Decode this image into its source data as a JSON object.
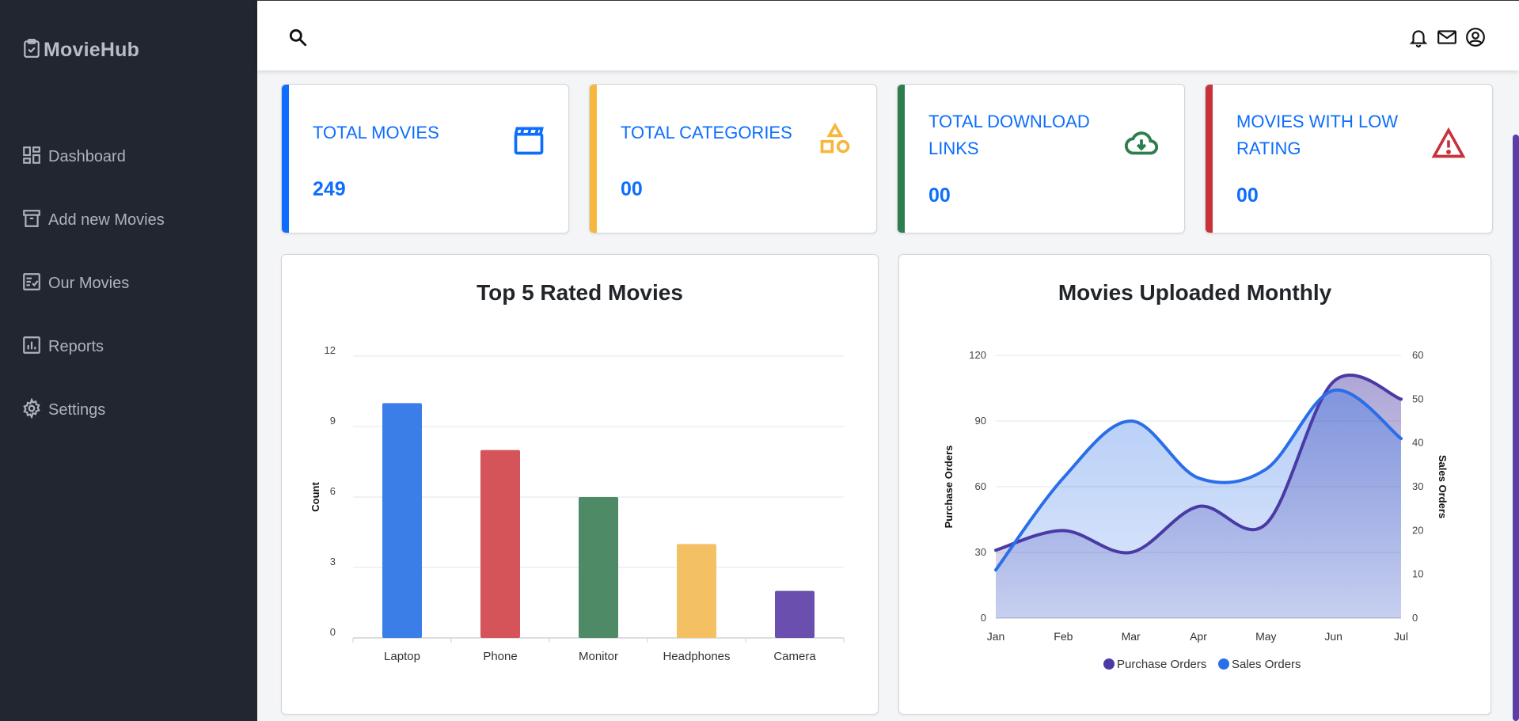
{
  "sidebar": {
    "brand": "MovieHub",
    "items": [
      {
        "label": "Dashboard",
        "icon": "dashboard-icon"
      },
      {
        "label": "Add new Movies",
        "icon": "archive-icon"
      },
      {
        "label": "Our Movies",
        "icon": "list-check-icon"
      },
      {
        "label": "Reports",
        "icon": "bar-chart-icon"
      },
      {
        "label": "Settings",
        "icon": "gear-icon"
      }
    ]
  },
  "topbar": {
    "icons": [
      "search-icon",
      "bell-icon",
      "mail-icon",
      "user-circle-icon"
    ]
  },
  "stats": [
    {
      "title": "TOTAL MOVIES",
      "value": "249",
      "accent": "#0d6efd",
      "icon": "clapperboard-icon"
    },
    {
      "title": "TOTAL CATEGORIES",
      "value": "00",
      "accent": "#f6b73c",
      "icon": "shapes-icon"
    },
    {
      "title": "TOTAL DOWNLOAD LINKS",
      "value": "00",
      "accent": "#2e7d4f",
      "icon": "cloud-download-icon"
    },
    {
      "title": "MOVIES WITH LOW RATING",
      "value": "00",
      "accent": "#c8333b",
      "icon": "warning-icon"
    }
  ],
  "chart_data": [
    {
      "type": "bar",
      "title": "Top 5 Rated Movies",
      "ylabel": "Count",
      "xlabel": "",
      "categories": [
        "Laptop",
        "Phone",
        "Monitor",
        "Headphones",
        "Camera"
      ],
      "values": [
        10,
        8,
        6,
        4,
        2
      ],
      "colors": [
        "#3b7ee8",
        "#d4545a",
        "#4f8a66",
        "#f4c064",
        "#6a4fae"
      ],
      "ylim": [
        0,
        12
      ],
      "yticks": [
        "0",
        "3",
        "6",
        "9",
        "12"
      ],
      "grid": true
    },
    {
      "type": "area",
      "title": "Movies Uploaded Monthly",
      "x": [
        "Jan",
        "Feb",
        "Mar",
        "Apr",
        "May",
        "Jun",
        "Jul"
      ],
      "series": [
        {
          "name": "Purchase Orders",
          "axis": "left",
          "color": "#4a3aa4",
          "values": [
            31,
            40,
            30,
            51,
            43,
            108,
            100
          ]
        },
        {
          "name": "Sales Orders",
          "axis": "right",
          "color": "#2a6ee8",
          "values": [
            11,
            32,
            45,
            32,
            34,
            52,
            41
          ]
        }
      ],
      "ylabel_left": "Purchase Orders",
      "ylabel_right": "Sales Orders",
      "ylim_left": [
        0,
        120
      ],
      "ylim_right": [
        0,
        60
      ],
      "yticks_left": [
        "0",
        "30",
        "60",
        "90",
        "120"
      ],
      "yticks_right": [
        "0",
        "10",
        "20",
        "30",
        "40",
        "50",
        "60"
      ],
      "legend": "bottom",
      "grid": true
    }
  ]
}
